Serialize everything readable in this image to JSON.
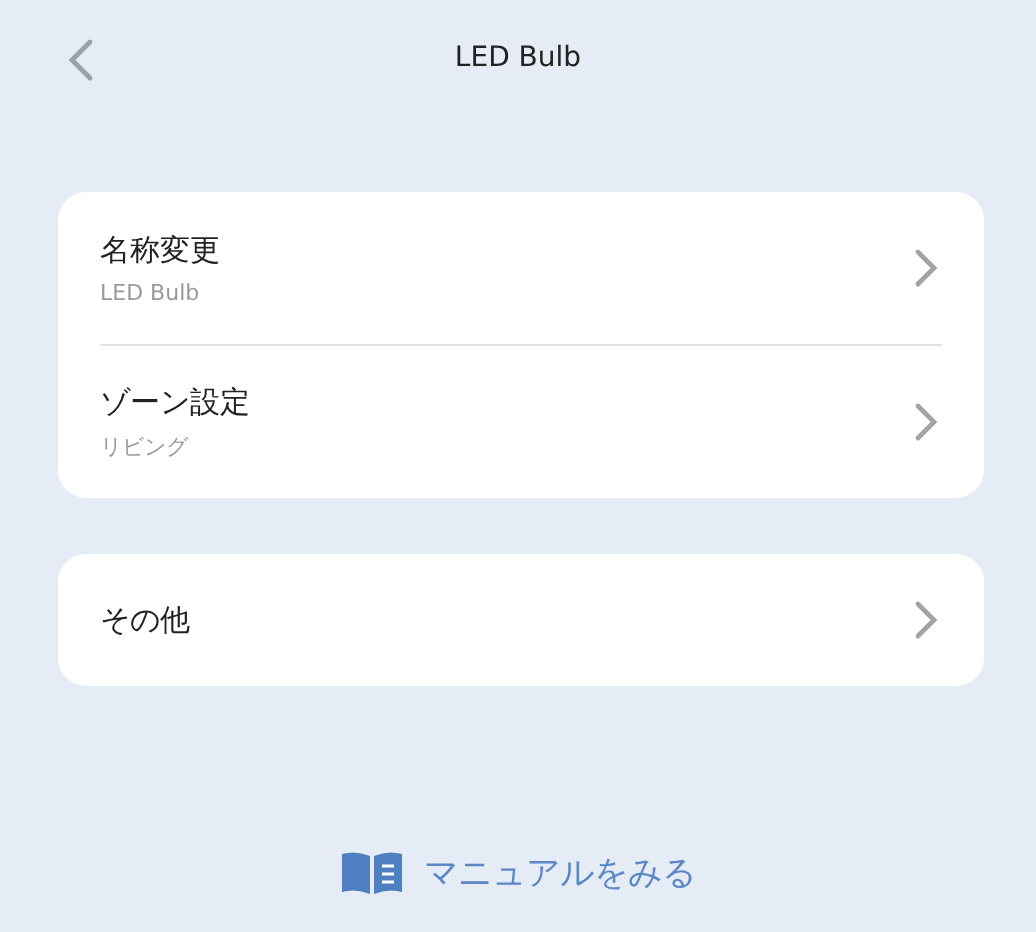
{
  "header": {
    "title": "LED Bulb"
  },
  "sections": [
    {
      "items": [
        {
          "label": "名称変更",
          "value": "LED Bulb"
        },
        {
          "label": "ゾーン設定",
          "value": "リビング"
        }
      ]
    },
    {
      "items": [
        {
          "label": "その他"
        }
      ]
    }
  ],
  "manual_link": {
    "label": "マニュアルをみる"
  }
}
